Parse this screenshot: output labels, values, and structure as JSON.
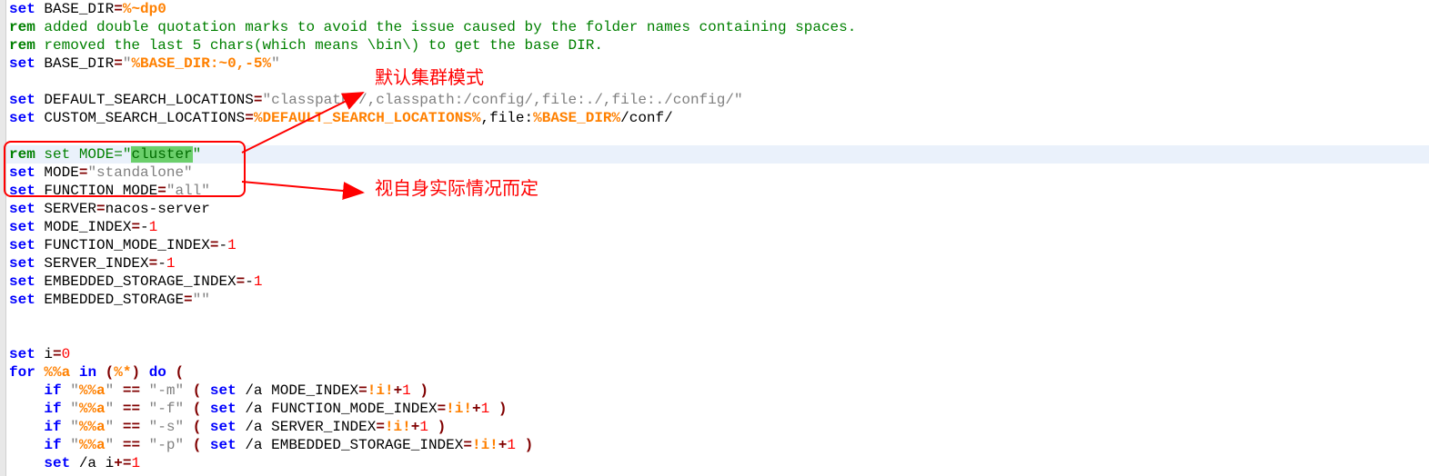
{
  "annotation1": "默认集群模式",
  "annotation2": "视自身实际情况而定",
  "lines": [
    [
      [
        "kw",
        "set"
      ],
      [
        "txt",
        " BASE_DIR"
      ],
      [
        "op",
        "="
      ],
      [
        "var",
        "%~dp0"
      ]
    ],
    [
      [
        "remb",
        "rem"
      ],
      [
        "rem",
        " added double quotation marks to avoid the issue caused by the folder names containing spaces."
      ]
    ],
    [
      [
        "remb",
        "rem"
      ],
      [
        "rem",
        " removed the last 5 chars(which means \\bin\\) to get the base DIR."
      ]
    ],
    [
      [
        "kw",
        "set"
      ],
      [
        "txt",
        " BASE_DIR"
      ],
      [
        "op",
        "="
      ],
      [
        "str",
        "\""
      ],
      [
        "var",
        "%BASE_DIR:~0,-5%"
      ],
      [
        "str",
        "\""
      ]
    ],
    [
      [
        "txt",
        ""
      ]
    ],
    [
      [
        "kw",
        "set"
      ],
      [
        "txt",
        " DEFAULT_SEARCH_LOCATIONS"
      ],
      [
        "op",
        "="
      ],
      [
        "str",
        "\"classpath:/,classpath:/config/,file:./,file:./config/\""
      ]
    ],
    [
      [
        "kw",
        "set"
      ],
      [
        "txt",
        " CUSTOM_SEARCH_LOCATIONS"
      ],
      [
        "op",
        "="
      ],
      [
        "var",
        "%DEFAULT_SEARCH_LOCATIONS%"
      ],
      [
        "txt",
        ",file:"
      ],
      [
        "var",
        "%BASE_DIR%"
      ],
      [
        "txt",
        "/conf/"
      ]
    ],
    [
      [
        "txt",
        ""
      ]
    ],
    [
      [
        "remb",
        "rem"
      ],
      [
        "rem",
        " set MODE=\""
      ],
      [
        "hl",
        "cluster"
      ],
      [
        "rem",
        "\""
      ]
    ],
    [
      [
        "kw",
        "set"
      ],
      [
        "txt",
        " MODE"
      ],
      [
        "op",
        "="
      ],
      [
        "str",
        "\"standalone\""
      ]
    ],
    [
      [
        "kw",
        "set"
      ],
      [
        "txt",
        " FUNCTION_MODE"
      ],
      [
        "op",
        "="
      ],
      [
        "str",
        "\"all\""
      ]
    ],
    [
      [
        "kw",
        "set"
      ],
      [
        "txt",
        " SERVER"
      ],
      [
        "op",
        "="
      ],
      [
        "txt",
        "nacos-server"
      ]
    ],
    [
      [
        "kw",
        "set"
      ],
      [
        "txt",
        " MODE_INDEX"
      ],
      [
        "op",
        "="
      ],
      [
        "txt",
        "-"
      ],
      [
        "num",
        "1"
      ]
    ],
    [
      [
        "kw",
        "set"
      ],
      [
        "txt",
        " FUNCTION_MODE_INDEX"
      ],
      [
        "op",
        "="
      ],
      [
        "txt",
        "-"
      ],
      [
        "num",
        "1"
      ]
    ],
    [
      [
        "kw",
        "set"
      ],
      [
        "txt",
        " SERVER_INDEX"
      ],
      [
        "op",
        "="
      ],
      [
        "txt",
        "-"
      ],
      [
        "num",
        "1"
      ]
    ],
    [
      [
        "kw",
        "set"
      ],
      [
        "txt",
        " EMBEDDED_STORAGE_INDEX"
      ],
      [
        "op",
        "="
      ],
      [
        "txt",
        "-"
      ],
      [
        "num",
        "1"
      ]
    ],
    [
      [
        "kw",
        "set"
      ],
      [
        "txt",
        " EMBEDDED_STORAGE"
      ],
      [
        "op",
        "="
      ],
      [
        "str",
        "\"\""
      ]
    ],
    [
      [
        "txt",
        ""
      ]
    ],
    [
      [
        "txt",
        ""
      ]
    ],
    [
      [
        "kw",
        "set"
      ],
      [
        "txt",
        " i"
      ],
      [
        "op",
        "="
      ],
      [
        "num",
        "0"
      ]
    ],
    [
      [
        "kw",
        "for"
      ],
      [
        "txt",
        " "
      ],
      [
        "var",
        "%%a"
      ],
      [
        "txt",
        " "
      ],
      [
        "kw",
        "in"
      ],
      [
        "txt",
        " "
      ],
      [
        "op",
        "("
      ],
      [
        "var",
        "%*"
      ],
      [
        "op",
        ")"
      ],
      [
        "txt",
        " "
      ],
      [
        "kw",
        "do"
      ],
      [
        "txt",
        " "
      ],
      [
        "op",
        "("
      ]
    ],
    [
      [
        "txt",
        "    "
      ],
      [
        "kw",
        "if"
      ],
      [
        "txt",
        " "
      ],
      [
        "str",
        "\""
      ],
      [
        "var",
        "%%a"
      ],
      [
        "str",
        "\""
      ],
      [
        "txt",
        " "
      ],
      [
        "op",
        "=="
      ],
      [
        "txt",
        " "
      ],
      [
        "str",
        "\"-m\""
      ],
      [
        "txt",
        " "
      ],
      [
        "op",
        "("
      ],
      [
        "txt",
        " "
      ],
      [
        "kw",
        "set"
      ],
      [
        "txt",
        " /a MODE_INDEX"
      ],
      [
        "op",
        "="
      ],
      [
        "var",
        "!i!"
      ],
      [
        "op",
        "+"
      ],
      [
        "num",
        "1"
      ],
      [
        "txt",
        " "
      ],
      [
        "op",
        ")"
      ]
    ],
    [
      [
        "txt",
        "    "
      ],
      [
        "kw",
        "if"
      ],
      [
        "txt",
        " "
      ],
      [
        "str",
        "\""
      ],
      [
        "var",
        "%%a"
      ],
      [
        "str",
        "\""
      ],
      [
        "txt",
        " "
      ],
      [
        "op",
        "=="
      ],
      [
        "txt",
        " "
      ],
      [
        "str",
        "\"-f\""
      ],
      [
        "txt",
        " "
      ],
      [
        "op",
        "("
      ],
      [
        "txt",
        " "
      ],
      [
        "kw",
        "set"
      ],
      [
        "txt",
        " /a FUNCTION_MODE_INDEX"
      ],
      [
        "op",
        "="
      ],
      [
        "var",
        "!i!"
      ],
      [
        "op",
        "+"
      ],
      [
        "num",
        "1"
      ],
      [
        "txt",
        " "
      ],
      [
        "op",
        ")"
      ]
    ],
    [
      [
        "txt",
        "    "
      ],
      [
        "kw",
        "if"
      ],
      [
        "txt",
        " "
      ],
      [
        "str",
        "\""
      ],
      [
        "var",
        "%%a"
      ],
      [
        "str",
        "\""
      ],
      [
        "txt",
        " "
      ],
      [
        "op",
        "=="
      ],
      [
        "txt",
        " "
      ],
      [
        "str",
        "\"-s\""
      ],
      [
        "txt",
        " "
      ],
      [
        "op",
        "("
      ],
      [
        "txt",
        " "
      ],
      [
        "kw",
        "set"
      ],
      [
        "txt",
        " /a SERVER_INDEX"
      ],
      [
        "op",
        "="
      ],
      [
        "var",
        "!i!"
      ],
      [
        "op",
        "+"
      ],
      [
        "num",
        "1"
      ],
      [
        "txt",
        " "
      ],
      [
        "op",
        ")"
      ]
    ],
    [
      [
        "txt",
        "    "
      ],
      [
        "kw",
        "if"
      ],
      [
        "txt",
        " "
      ],
      [
        "str",
        "\""
      ],
      [
        "var",
        "%%a"
      ],
      [
        "str",
        "\""
      ],
      [
        "txt",
        " "
      ],
      [
        "op",
        "=="
      ],
      [
        "txt",
        " "
      ],
      [
        "str",
        "\"-p\""
      ],
      [
        "txt",
        " "
      ],
      [
        "op",
        "("
      ],
      [
        "txt",
        " "
      ],
      [
        "kw",
        "set"
      ],
      [
        "txt",
        " /a EMBEDDED_STORAGE_INDEX"
      ],
      [
        "op",
        "="
      ],
      [
        "var",
        "!i!"
      ],
      [
        "op",
        "+"
      ],
      [
        "num",
        "1"
      ],
      [
        "txt",
        " "
      ],
      [
        "op",
        ")"
      ]
    ],
    [
      [
        "txt",
        "    "
      ],
      [
        "kw",
        "set"
      ],
      [
        "txt",
        " /a i"
      ],
      [
        "op",
        "+="
      ],
      [
        "num",
        "1"
      ]
    ]
  ]
}
